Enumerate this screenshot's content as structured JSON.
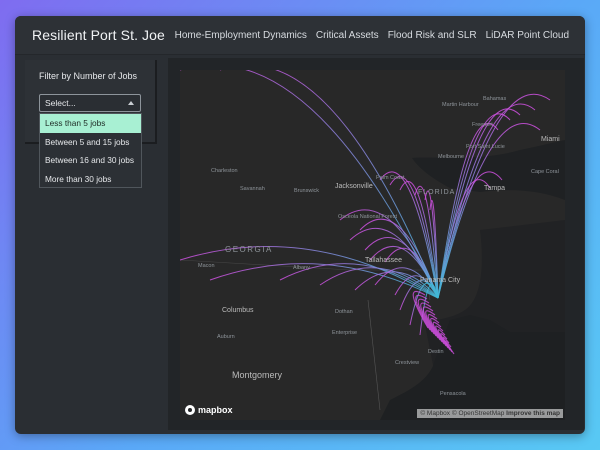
{
  "app": {
    "title": "Resilient Port St. Joe"
  },
  "nav": [
    {
      "label": "Home-Employment Dynamics"
    },
    {
      "label": "Critical Assets"
    },
    {
      "label": "Flood Risk and SLR"
    },
    {
      "label": "LiDAR Point Cloud"
    }
  ],
  "filter": {
    "label": "Filter by Number of Jobs",
    "placeholder": "Select...",
    "options": [
      {
        "label": "Less than 5 jobs",
        "highlighted": true
      },
      {
        "label": "Between 5 and 15 jobs",
        "highlighted": false
      },
      {
        "label": "Between 16 and 30 jobs",
        "highlighted": false
      },
      {
        "label": "More than 30 jobs",
        "highlighted": false
      }
    ]
  },
  "map": {
    "logo": "mapbox",
    "attribution": {
      "mapbox": "© Mapbox",
      "osm": "© OpenStreetMap",
      "improve": "Improve this map"
    },
    "places": [
      {
        "name": "Martin Harbour"
      },
      {
        "name": "Bahamas"
      },
      {
        "name": "Freeport"
      },
      {
        "name": "Miami"
      },
      {
        "name": "Port Saint Lucie"
      },
      {
        "name": "Melbourne"
      },
      {
        "name": "Cape Coral"
      },
      {
        "name": "Tampa"
      },
      {
        "name": "Palm Coast"
      },
      {
        "name": "FLORIDA"
      },
      {
        "name": "Charleston"
      },
      {
        "name": "Savannah"
      },
      {
        "name": "Brunswick"
      },
      {
        "name": "Jacksonville"
      },
      {
        "name": "Osceola National Forest"
      },
      {
        "name": "GEORGIA"
      },
      {
        "name": "Macon"
      },
      {
        "name": "Albany"
      },
      {
        "name": "Tallahassee"
      },
      {
        "name": "Panama City"
      },
      {
        "name": "Columbus"
      },
      {
        "name": "Dothan"
      },
      {
        "name": "Enterprise"
      },
      {
        "name": "Auburn"
      },
      {
        "name": "Crestview"
      },
      {
        "name": "Destin"
      },
      {
        "name": "Montgomery"
      },
      {
        "name": "Pensacola"
      }
    ]
  },
  "colors": {
    "accent": "#a8f0d3",
    "flow_cyan": "#3fb9d6",
    "flow_magenta": "#cf4fe0"
  }
}
